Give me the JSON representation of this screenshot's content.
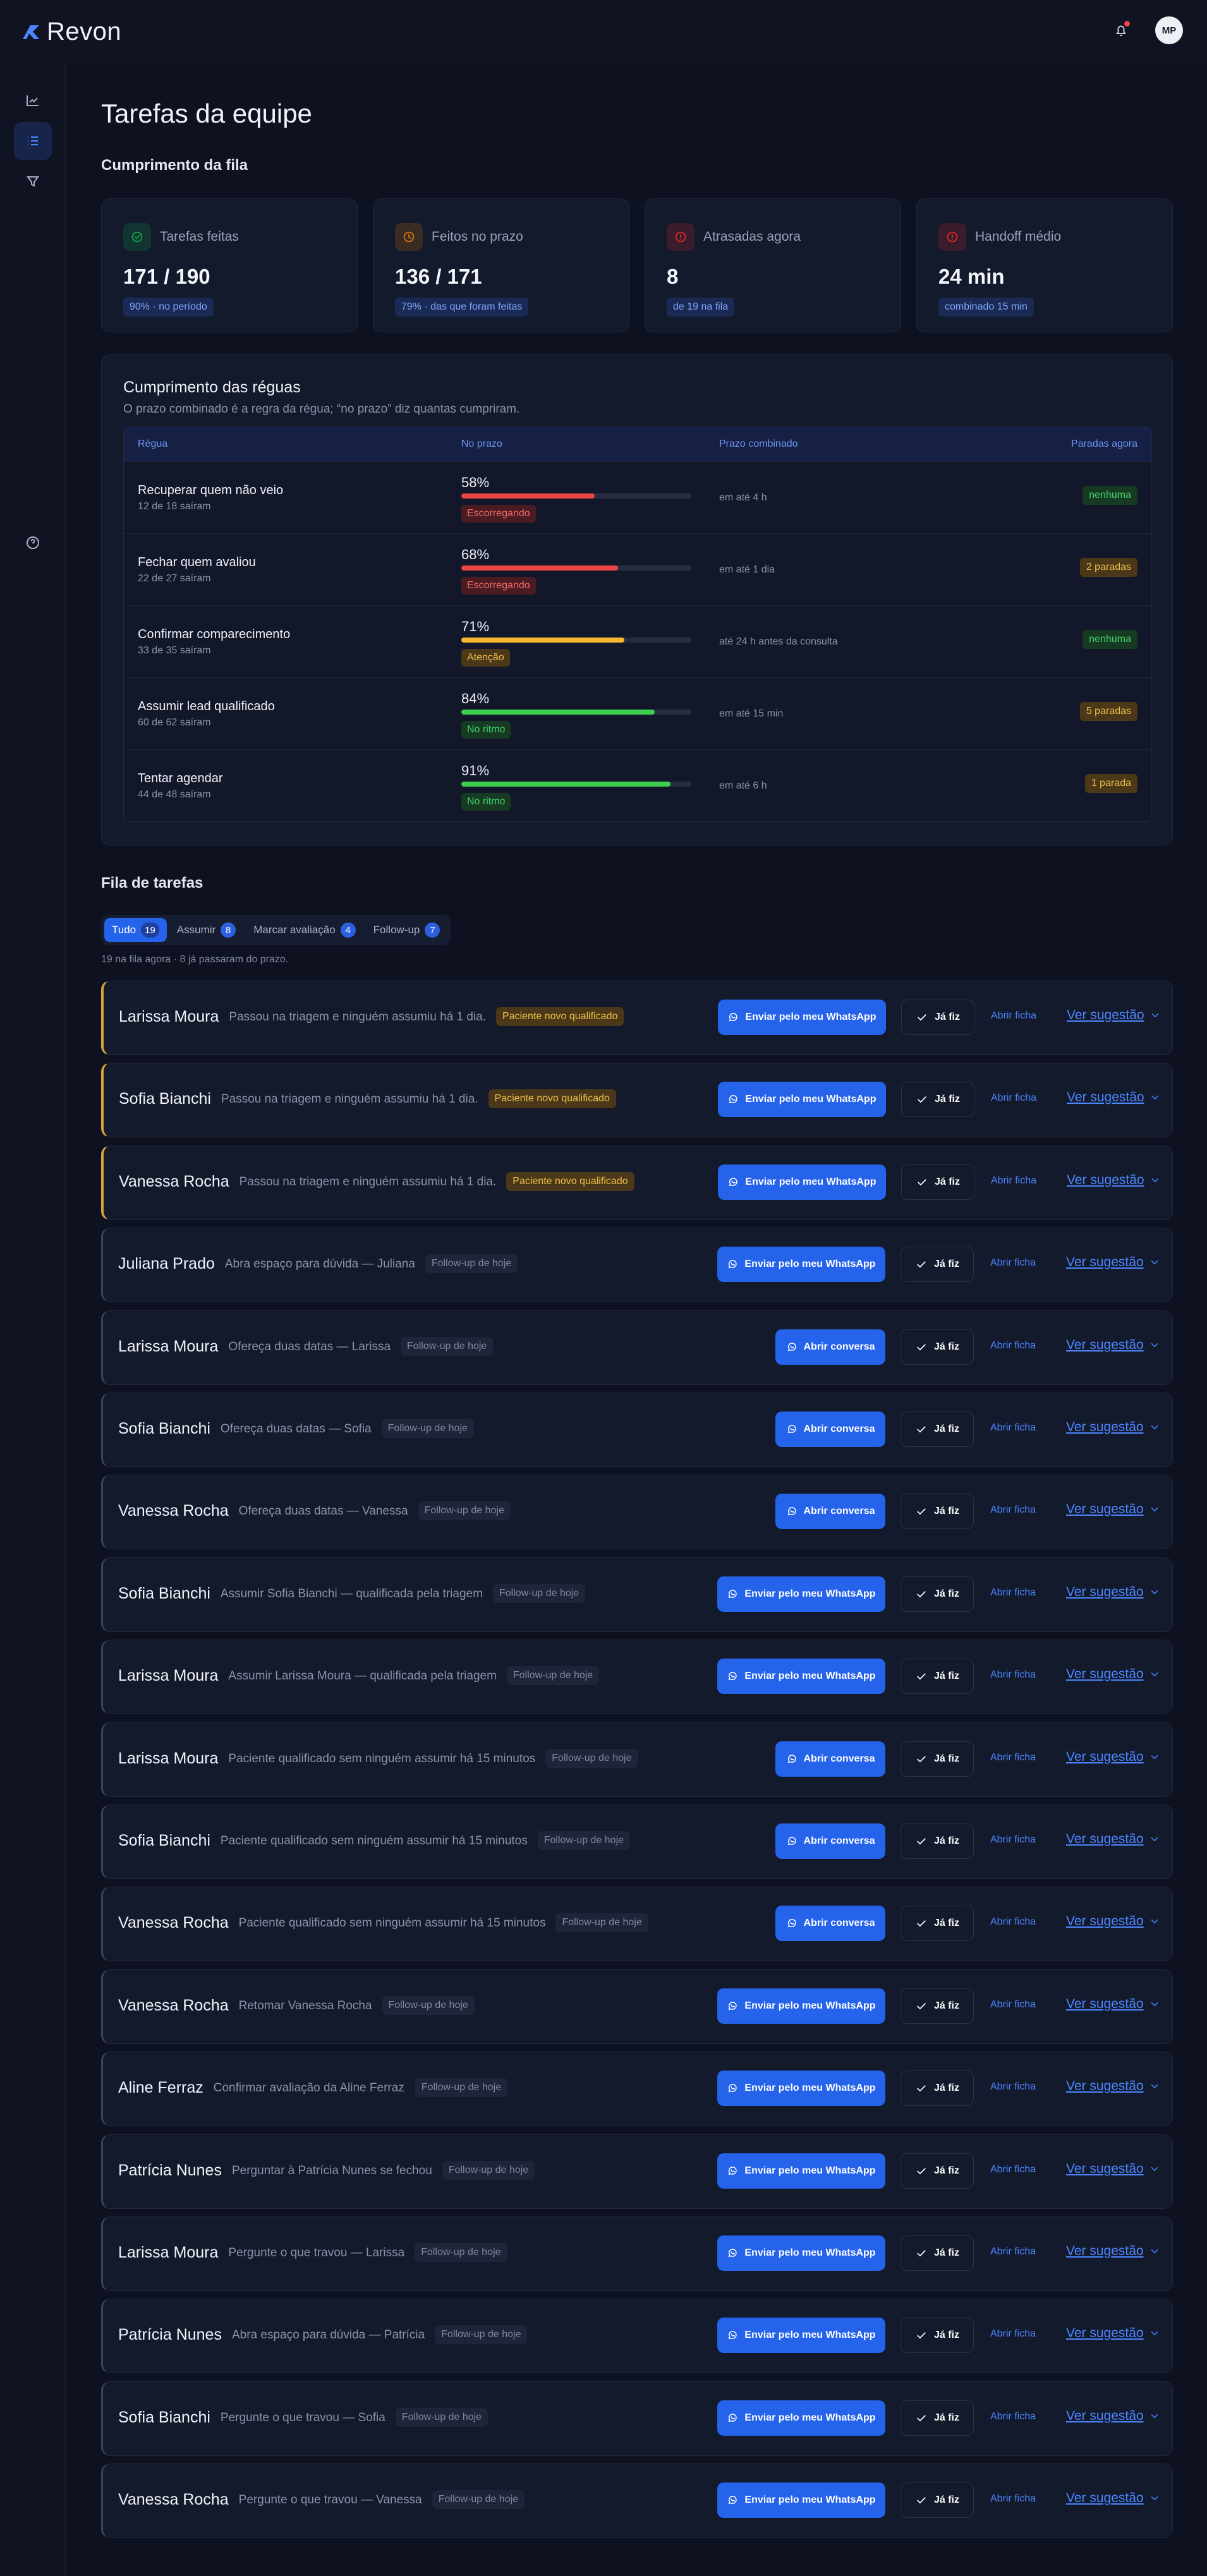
{
  "app": {
    "brand": "Revon",
    "avatar_initials": "MP"
  },
  "page": {
    "title": "Tarefas da equipe"
  },
  "fila_section": {
    "title": "Cumprimento da fila"
  },
  "kpis": [
    {
      "label": "Tarefas feitas",
      "value": "171 / 190",
      "sub": "90% · no período",
      "icon": "check-circle-icon",
      "tone": "#16a34a"
    },
    {
      "label": "Feitos no prazo",
      "value": "136 / 171",
      "sub": "79% · das que foram feitas",
      "icon": "clock-icon",
      "tone": "#d97706"
    },
    {
      "label": "Atrasadas agora",
      "value": "8",
      "sub": "de 19 na fila",
      "icon": "alert-icon",
      "tone": "#dc2626"
    },
    {
      "label": "Handoff médio",
      "value": "24 min",
      "sub": "combinado 15 min",
      "icon": "alert-icon",
      "tone": "#dc2626"
    }
  ],
  "rules": {
    "title": "Cumprimento das réguas",
    "subtitle": "O prazo combinado é a regra da régua; “no prazo” diz quantas cumpriram.",
    "columns": {
      "regua": "Régua",
      "no_prazo": "No prazo",
      "prazo": "Prazo combinado",
      "paradas": "Paradas agora"
    },
    "rows": [
      {
        "name": "Recuperar quem não veio",
        "count": "12 de 18 saíram",
        "pct_label": "58%",
        "pct": 58,
        "status": "Escorregando",
        "tone": "red",
        "deadline": "em até 4 h",
        "stopped": "nenhuma",
        "stopped_tone": "green"
      },
      {
        "name": "Fechar quem avaliou",
        "count": "22 de 27 saíram",
        "pct_label": "68%",
        "pct": 68,
        "status": "Escorregando",
        "tone": "red",
        "deadline": "em até 1 dia",
        "stopped": "2 paradas",
        "stopped_tone": "amber"
      },
      {
        "name": "Confirmar comparecimento",
        "count": "33 de 35 saíram",
        "pct_label": "71%",
        "pct": 71,
        "status": "Atenção",
        "tone": "amber",
        "deadline": "até 24 h antes da consulta",
        "stopped": "nenhuma",
        "stopped_tone": "green"
      },
      {
        "name": "Assumir lead qualificado",
        "count": "60 de 62 saíram",
        "pct_label": "84%",
        "pct": 84,
        "status": "No ritmo",
        "tone": "green",
        "deadline": "em até 15 min",
        "stopped": "5 paradas",
        "stopped_tone": "amber"
      },
      {
        "name": "Tentar agendar",
        "count": "44 de 48 saíram",
        "pct_label": "91%",
        "pct": 91,
        "status": "No ritmo",
        "tone": "green",
        "deadline": "em até 6 h",
        "stopped": "1 parada",
        "stopped_tone": "amber"
      }
    ]
  },
  "queue": {
    "title": "Fila de tarefas",
    "tabs": [
      {
        "label": "Tudo",
        "count": "19",
        "active": true
      },
      {
        "label": "Assumir",
        "count": "8",
        "active": false
      },
      {
        "label": "Marcar avaliação",
        "count": "4",
        "active": false
      },
      {
        "label": "Follow-up",
        "count": "7",
        "active": false
      }
    ],
    "meta": "19 na fila agora · 8 já passaram do prazo.",
    "labels": {
      "whatsapp": "Enviar pelo meu WhatsApp",
      "conversation": "Abrir conversa",
      "done": "Já fiz",
      "open_file": "Abrir ficha",
      "suggest": "Ver sugestão"
    },
    "tasks": [
      {
        "name": "Larissa Moura",
        "desc": "Passou na triagem e ninguém assumiu há 1 dia.",
        "badge": "Paciente novo qualificado",
        "badge_tone": "warn",
        "action": "whatsapp"
      },
      {
        "name": "Sofia Bianchi",
        "desc": "Passou na triagem e ninguém assumiu há 1 dia.",
        "badge": "Paciente novo qualificado",
        "badge_tone": "warn",
        "action": "whatsapp"
      },
      {
        "name": "Vanessa Rocha",
        "desc": "Passou na triagem e ninguém assumiu há 1 dia.",
        "badge": "Paciente novo qualificado",
        "badge_tone": "warn",
        "action": "whatsapp"
      },
      {
        "name": "Juliana Prado",
        "desc": "Abra espaço para dúvida — Juliana",
        "badge": "Follow-up de hoje",
        "badge_tone": "neutral",
        "action": "whatsapp"
      },
      {
        "name": "Larissa Moura",
        "desc": "Ofereça duas datas — Larissa",
        "badge": "Follow-up de hoje",
        "badge_tone": "neutral",
        "action": "conversation"
      },
      {
        "name": "Sofia Bianchi",
        "desc": "Ofereça duas datas — Sofia",
        "badge": "Follow-up de hoje",
        "badge_tone": "neutral",
        "action": "conversation"
      },
      {
        "name": "Vanessa Rocha",
        "desc": "Ofereça duas datas — Vanessa",
        "badge": "Follow-up de hoje",
        "badge_tone": "neutral",
        "action": "conversation"
      },
      {
        "name": "Sofia Bianchi",
        "desc": "Assumir Sofia Bianchi — qualificada pela triagem",
        "badge": "Follow-up de hoje",
        "badge_tone": "neutral",
        "action": "whatsapp"
      },
      {
        "name": "Larissa Moura",
        "desc": "Assumir Larissa Moura — qualificada pela triagem",
        "badge": "Follow-up de hoje",
        "badge_tone": "neutral",
        "action": "whatsapp"
      },
      {
        "name": "Larissa Moura",
        "desc": "Paciente qualificado sem ninguém assumir há 15 minutos",
        "badge": "Follow-up de hoje",
        "badge_tone": "neutral",
        "action": "conversation"
      },
      {
        "name": "Sofia Bianchi",
        "desc": "Paciente qualificado sem ninguém assumir há 15 minutos",
        "badge": "Follow-up de hoje",
        "badge_tone": "neutral",
        "action": "conversation"
      },
      {
        "name": "Vanessa Rocha",
        "desc": "Paciente qualificado sem ninguém assumir há 15 minutos",
        "badge": "Follow-up de hoje",
        "badge_tone": "neutral",
        "action": "conversation"
      },
      {
        "name": "Vanessa Rocha",
        "desc": "Retomar Vanessa Rocha",
        "badge": "Follow-up de hoje",
        "badge_tone": "neutral",
        "action": "whatsapp"
      },
      {
        "name": "Aline Ferraz",
        "desc": "Confirmar avaliação da Aline Ferraz",
        "badge": "Follow-up de hoje",
        "badge_tone": "neutral",
        "action": "whatsapp"
      },
      {
        "name": "Patrícia Nunes",
        "desc": "Perguntar à Patrícia Nunes se fechou",
        "badge": "Follow-up de hoje",
        "badge_tone": "neutral",
        "action": "whatsapp"
      },
      {
        "name": "Larissa Moura",
        "desc": "Pergunte o que travou — Larissa",
        "badge": "Follow-up de hoje",
        "badge_tone": "neutral",
        "action": "whatsapp"
      },
      {
        "name": "Patrícia Nunes",
        "desc": "Abra espaço para dúvida — Patrícia",
        "badge": "Follow-up de hoje",
        "badge_tone": "neutral",
        "action": "whatsapp"
      },
      {
        "name": "Sofia Bianchi",
        "desc": "Pergunte o que travou — Sofia",
        "badge": "Follow-up de hoje",
        "badge_tone": "neutral",
        "action": "whatsapp"
      },
      {
        "name": "Vanessa Rocha",
        "desc": "Pergunte o que travou — Vanessa",
        "badge": "Follow-up de hoje",
        "badge_tone": "neutral",
        "action": "whatsapp"
      }
    ]
  }
}
